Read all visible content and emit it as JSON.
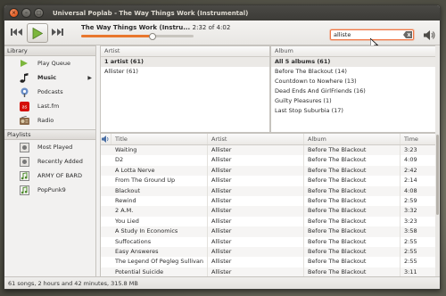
{
  "window": {
    "title": "Universal Poplab - The Way Things Work (Instrumental)",
    "close_glyph": "×",
    "minimize_glyph": "–",
    "maximize_glyph": "□"
  },
  "player": {
    "now_playing_title": "The Way Things Work (Instru...",
    "now_playing_time": "2:32 of 4:02",
    "progress_fraction": 0.627,
    "accent_color": "#e8772e"
  },
  "search": {
    "value": "alliste",
    "clear_icon": "clear-icon"
  },
  "sidebar": {
    "library_header": "Library",
    "library_items": [
      {
        "label": "Play Queue",
        "icon": "play-queue-icon"
      },
      {
        "label": "Music",
        "icon": "music-note-icon",
        "selected": true
      },
      {
        "label": "Podcasts",
        "icon": "podcast-icon"
      },
      {
        "label": "Last.fm",
        "icon": "lastfm-icon"
      },
      {
        "label": "Radio",
        "icon": "radio-icon"
      }
    ],
    "playlists_header": "Playlists",
    "playlist_items": [
      {
        "label": "Most Played",
        "icon": "smart-playlist-icon"
      },
      {
        "label": "Recently Added",
        "icon": "smart-playlist-icon"
      },
      {
        "label": "ARMY OF BARD",
        "icon": "playlist-icon"
      },
      {
        "label": "PopPunk9",
        "icon": "playlist-icon"
      }
    ]
  },
  "artist_pane": {
    "header": "Artist",
    "rows": [
      "1 artist (61)",
      "Allister (61)"
    ]
  },
  "album_pane": {
    "header": "Album",
    "rows": [
      "All 5 albums (61)",
      "Before The Blackout (14)",
      "Countdown to Nowhere (13)",
      "Dead Ends And GirlFriends (16)",
      "Guilty Pleasures (1)",
      "Last Stop Suburbia (17)"
    ]
  },
  "tracks": {
    "columns": [
      "Title",
      "Artist",
      "Album",
      "Time"
    ],
    "rows": [
      [
        "Waiting",
        "Allister",
        "Before The Blackout",
        "3:23"
      ],
      [
        "D2",
        "Allister",
        "Before The Blackout",
        "4:09"
      ],
      [
        "A Lotta Nerve",
        "Allister",
        "Before The Blackout",
        "2:42"
      ],
      [
        "From The Ground Up",
        "Allister",
        "Before The Blackout",
        "2:14"
      ],
      [
        "Blackout",
        "Allister",
        "Before The Blackout",
        "4:08"
      ],
      [
        "Rewind",
        "Allister",
        "Before The Blackout",
        "2:59"
      ],
      [
        "2 A.M.",
        "Allister",
        "Before The Blackout",
        "3:32"
      ],
      [
        "You Lied",
        "Allister",
        "Before The Blackout",
        "3:23"
      ],
      [
        "A Study In Economics",
        "Allister",
        "Before The Blackout",
        "3:58"
      ],
      [
        "Suffocations",
        "Allister",
        "Before The Blackout",
        "2:55"
      ],
      [
        "Easy Answeres",
        "Allister",
        "Before The Blackout",
        "2:55"
      ],
      [
        "The Legend Of Pegleg Sullivan",
        "Allister",
        "Before The Blackout",
        "2:55"
      ],
      [
        "Potential Suicide",
        "Allister",
        "Before The Blackout",
        "3:11"
      ]
    ]
  },
  "statusbar": {
    "text": "61 songs, 2 hours and 42 minutes, 315.8 MB"
  }
}
